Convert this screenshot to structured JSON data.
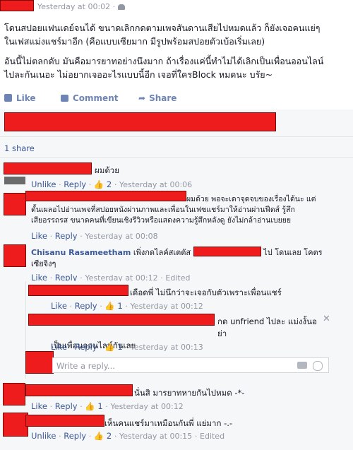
{
  "post": {
    "timestamp": "Yesterday at 00:02",
    "privacy_separator": "·",
    "line1": "โดนสปอยแฟนเดย์จนได้ ขนาดเลิกกดตามเพจสันดานเสียไปหมดแล้ว ก็ยังเจอคนแย่ๆ",
    "line2": "ในเฟสแม่งแชร์มาอีก (คือแบบเซียมาก มีรูปพร้อมสปอยตัวเบ้อเริ่มเลย)",
    "line3": "อันนี้ไม่ตลกดับ มันคือมารยาทอย่างนึงมาก ถ้าเรื่องแค่นี้ทำไม่ได้เลิกเป็นเพื่อนออนไลน์",
    "line4": "ไปละกันเนอะ ไม่อยากเจออะไรแบบนี้อีก เจอที่ใครBlock หมดนะ บรัย~",
    "actions": {
      "like": "Like",
      "comment": "Comment",
      "share": "Share"
    },
    "shares": "1 share"
  },
  "comments": [
    {
      "text": "ผมด้วย",
      "unlike": "Unlike",
      "reply": "Reply",
      "likes": "2",
      "time": "Yesterday at 00:06",
      "dot": "·"
    },
    {
      "text_line1": "ผมด้วย พอจะเดาจุดจบของเรื่องได้นะ แต่",
      "text_line2": "ดั้นเผลอไปอ่านเพจที่สปอยหนังผ่านภาพและเพื่อนในเฟซแชร์มาให้อ่านผ่านฟีดส์ รู้สึก",
      "text_line3": "เสียอรรถรส ขนาดคนที่เขียนเชิงรีวิวหรือแสดงความรู้สึกหลังดู ยังไม่กล้าอ่านเบยยย",
      "like": "Like",
      "reply": "Reply",
      "time": "Yesterday at 00:08"
    },
    {
      "name": "Chisanu Rasameetham",
      "text_a": "เพิ่งกดไลค์สเตตัส",
      "text_b": "ไป โดนเลย โคตร",
      "text_line2": "เซียจิงๆ",
      "like": "Like",
      "reply": "Reply",
      "time": "Yesterday at 00:12",
      "edited": "Edited"
    }
  ],
  "replies": [
    {
      "text": "เดือดพี่ ไม่นึกว่าจะเจอกับตัวเพราะเพื่อนแชร์",
      "like": "Like",
      "reply": "Reply",
      "likes": "1",
      "time": "Yesterday at 00:12"
    },
    {
      "text_a": "กด unfriend ไปละ แม่งงั้นอย่า",
      "text_b": "เป็นเพื่อนออนไลน์กันเลย",
      "like": "Like",
      "reply": "Reply",
      "likes": "1",
      "time": "Yesterday at 00:13"
    }
  ],
  "reply_box": {
    "placeholder": "Write a reply..."
  },
  "later_comments": [
    {
      "text": "นั่นสิ มารยาทหายกันไปหมด -*-",
      "like": "Like",
      "reply": "Reply",
      "likes": "1",
      "time": "Yesterday at 00:12"
    },
    {
      "text": "เห็นคนแชร์มาเหมือนกันพี่ แย่มาก -.-",
      "unlike": "Unlike",
      "reply": "Reply",
      "likes": "2",
      "time": "Yesterday at 00:15",
      "edited": "Edited"
    }
  ],
  "colors": {
    "link": "#3b5998",
    "meta": "#9197a3",
    "redaction": "#ee1c1c",
    "action": "#6d84b4"
  }
}
